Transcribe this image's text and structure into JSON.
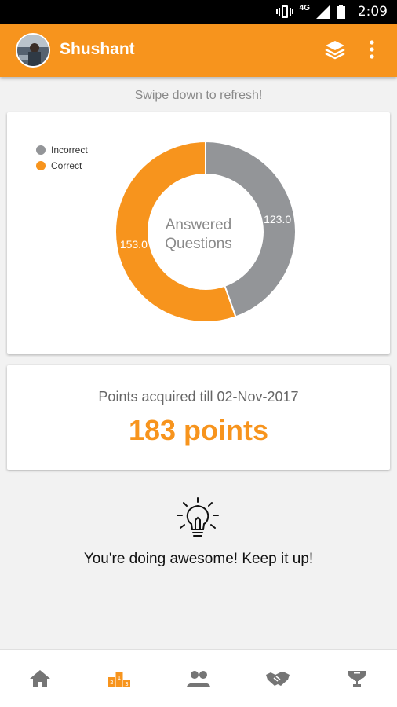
{
  "status_bar": {
    "time": "2:09",
    "network": "4G",
    "icons": [
      "vibrate-icon",
      "signal-icon",
      "battery-icon"
    ]
  },
  "app_bar": {
    "username": "Shushant",
    "actions": [
      "layers-icon",
      "more-vert-icon"
    ]
  },
  "refresh_hint": "Swipe down to refresh!",
  "chart_card": {
    "legend": [
      {
        "label": "Incorrect",
        "color": "#939598"
      },
      {
        "label": "Correct",
        "color": "#f7941d"
      }
    ],
    "center_text_line1": "Answered",
    "center_text_line2": "Questions"
  },
  "chart_data": {
    "type": "pie",
    "donut": true,
    "categories": [
      "Incorrect",
      "Correct"
    ],
    "values": [
      123.0,
      153.0
    ],
    "value_labels": [
      "123.0",
      "153.0"
    ],
    "colors": [
      "#939598",
      "#f7941d"
    ],
    "center_label": "Answered Questions",
    "legend_position": "top-left"
  },
  "points_card": {
    "label": "Points acquired till 02-Nov-2017",
    "value": "183 points"
  },
  "encouragement": "You're doing awesome! Keep it up!",
  "bottom_nav": [
    {
      "icon": "home-icon",
      "active": false
    },
    {
      "icon": "leaderboard-podium-icon",
      "active": true
    },
    {
      "icon": "people-icon",
      "active": false
    },
    {
      "icon": "handshake-icon",
      "active": false
    },
    {
      "icon": "trophy-icon",
      "active": false
    }
  ],
  "colors": {
    "accent": "#f7941d",
    "incorrect": "#939598",
    "inactive_icon": "#757575"
  }
}
